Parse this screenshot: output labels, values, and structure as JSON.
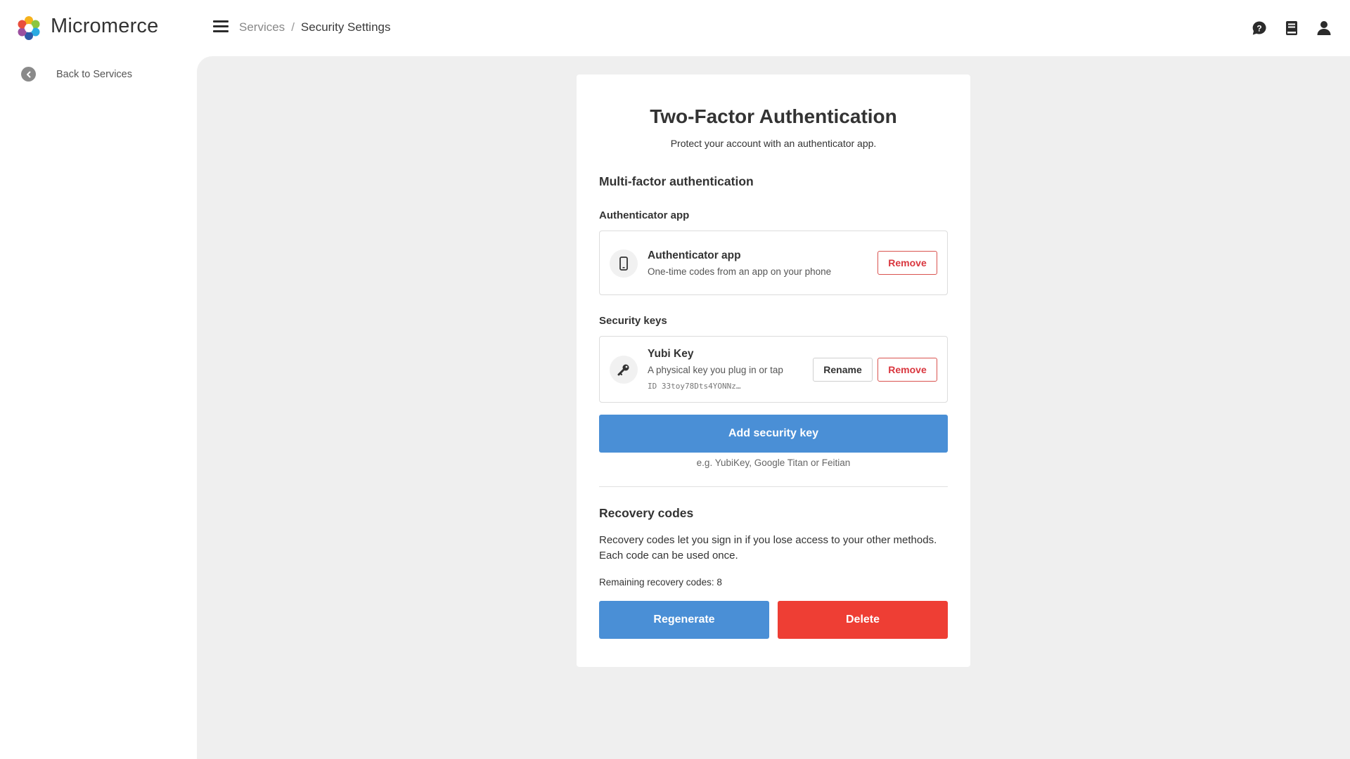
{
  "header": {
    "brand": "Micromerce",
    "breadcrumb": {
      "parent": "Services",
      "separator": "/",
      "current": "Security Settings"
    },
    "icons": [
      "help-chat-icon",
      "book-icon",
      "user-icon"
    ]
  },
  "sidebar": {
    "back_label": "Back to Services"
  },
  "card": {
    "title": "Two-Factor Authentication",
    "subtitle": "Protect your account with an authenticator app.",
    "mfa_title": "Multi-factor authentication",
    "authenticator": {
      "section_label": "Authenticator app",
      "name": "Authenticator app",
      "description": "One-time codes from an app on your phone",
      "remove_label": "Remove"
    },
    "security_keys": {
      "section_label": "Security keys",
      "name": "Yubi Key",
      "description": "A physical key you plug in or tap",
      "id_text": "ID 33toy78Dts4YONNz…",
      "rename_label": "Rename",
      "remove_label": "Remove",
      "add_label": "Add security key",
      "hint": "e.g. YubiKey, Google Titan or Feitian"
    },
    "recovery": {
      "title": "Recovery codes",
      "description": "Recovery codes let you sign in if you lose access to your other methods. Each code can be used once.",
      "remaining": "Remaining recovery codes: 8",
      "regenerate_label": "Regenerate",
      "delete_label": "Delete"
    }
  },
  "colors": {
    "primary": "#4a8fd6",
    "danger": "#ee3e34",
    "danger_text": "#d9363e",
    "background": "#efefef"
  }
}
